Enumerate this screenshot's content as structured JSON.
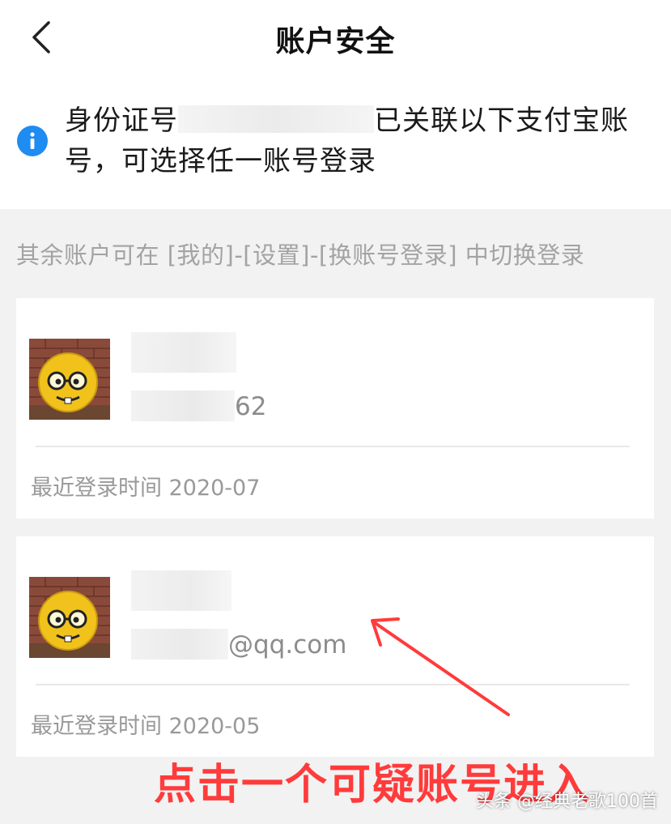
{
  "header": {
    "title": "账户安全",
    "back_icon": "chevron-left-icon"
  },
  "notice": {
    "icon": "info-icon",
    "prefix": "身份证号",
    "suffix": "已关联以下支付宝账号，可选择任一账号登录"
  },
  "hint": "其余账户可在 [我的]-[设置]-[换账号登录] 中切换登录",
  "accounts": [
    {
      "account_visible": "62",
      "last_login": "最近登录时间 2020-07"
    },
    {
      "account_visible": "@qq.com",
      "last_login": "最近登录时间 2020-05"
    }
  ],
  "annotation": {
    "text": "点击一个可疑账号进入",
    "color": "#ff3b3b"
  },
  "watermark": "头条 @经典老歌100首",
  "colors": {
    "info_blue": "#1e8cf0",
    "background": "#f2f2f2",
    "card": "#ffffff"
  }
}
